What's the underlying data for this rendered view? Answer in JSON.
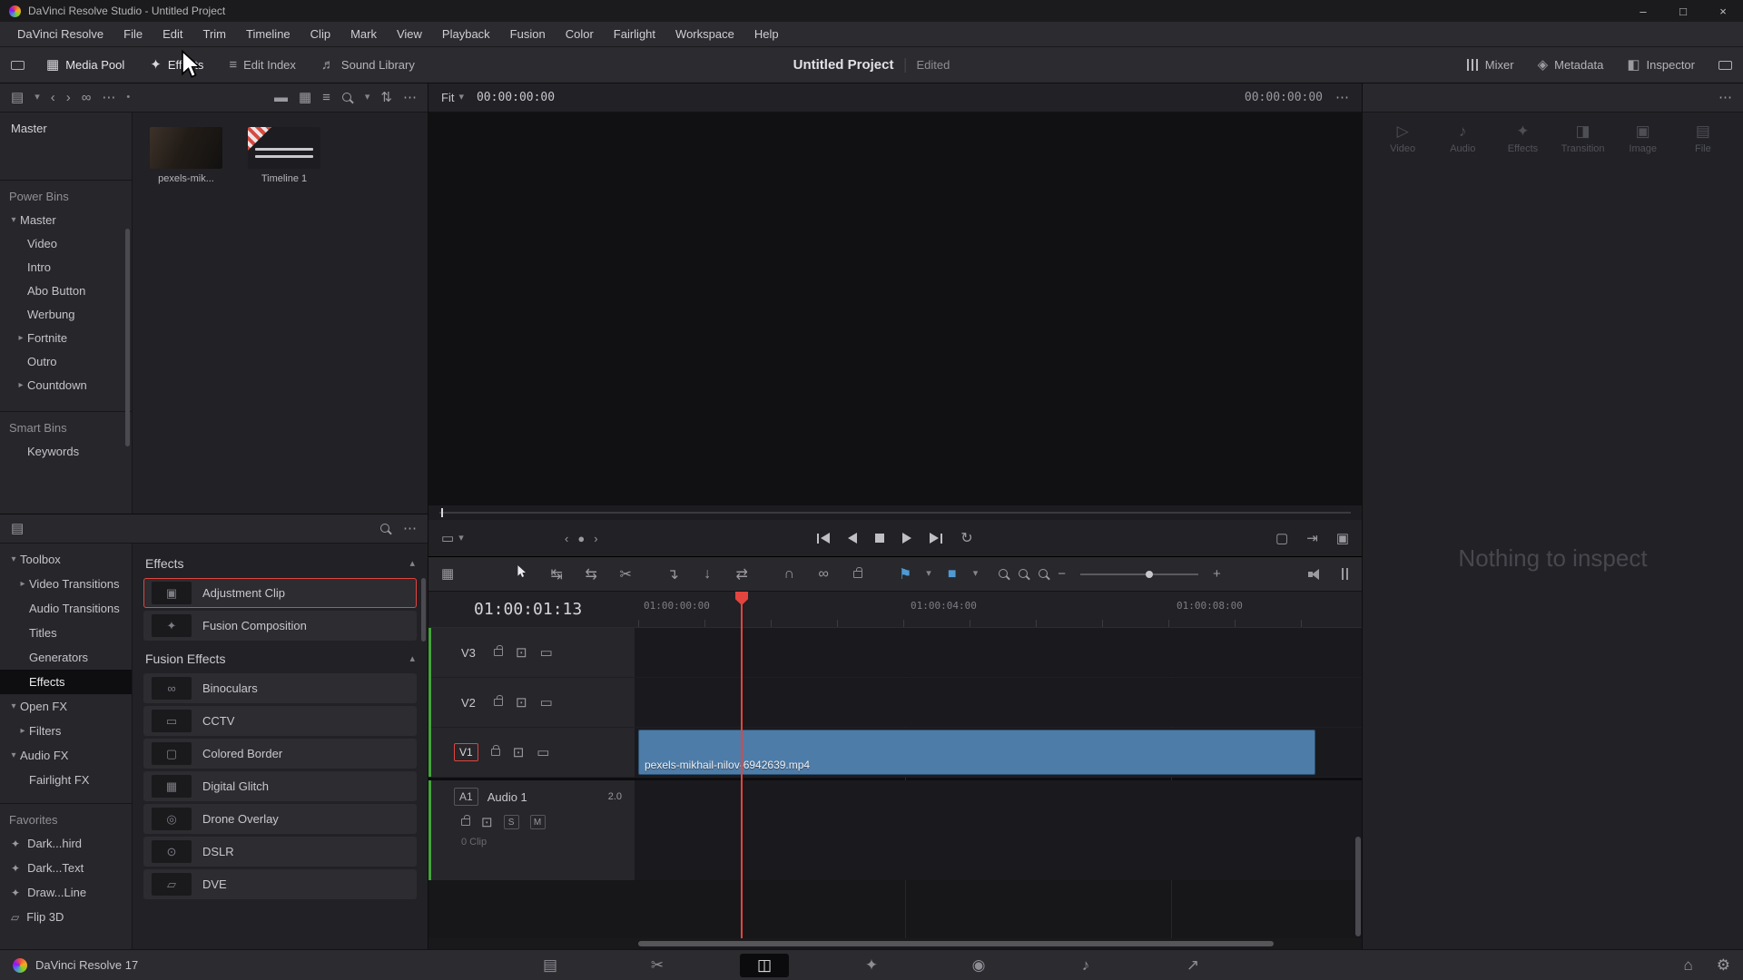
{
  "window": {
    "title": "DaVinci Resolve Studio - Untitled Project",
    "controls": {
      "minimize": "–",
      "maximize": "□",
      "close": "×"
    }
  },
  "menu": {
    "items": [
      "DaVinci Resolve",
      "File",
      "Edit",
      "Trim",
      "Timeline",
      "Clip",
      "Mark",
      "View",
      "Playback",
      "Fusion",
      "Color",
      "Fairlight",
      "Workspace",
      "Help"
    ]
  },
  "toolbar": {
    "media_pool": "Media Pool",
    "effects": "Effects",
    "edit_index": "Edit Index",
    "sound_library": "Sound Library",
    "project_title": "Untitled Project",
    "project_status": "Edited",
    "mixer": "Mixer",
    "metadata": "Metadata",
    "inspector": "Inspector"
  },
  "media_pool": {
    "root_bin": "Master",
    "power_bins_title": "Power Bins",
    "power_bins": [
      "Master",
      "Video",
      "Intro",
      "Abo Button",
      "Werbung",
      "Fortnite",
      "Outro",
      "Countdown"
    ],
    "smart_bins_title": "Smart Bins",
    "smart_bins": [
      "Keywords"
    ],
    "clips": [
      "pexels-mik...",
      "Timeline 1"
    ]
  },
  "effects_panel": {
    "tree": [
      "Toolbox",
      "Video Transitions",
      "Audio Transitions",
      "Titles",
      "Generators",
      "Effects",
      "Open FX",
      "Filters",
      "Audio FX",
      "Fairlight FX"
    ],
    "favorites_title": "Favorites",
    "favorites": [
      "Dark...hird",
      "Dark...Text",
      "Draw...Line",
      "Flip 3D"
    ],
    "effects_section_title": "Effects",
    "effects_items": [
      "Adjustment Clip",
      "Fusion Composition"
    ],
    "fusion_section_title": "Fusion Effects",
    "fusion_items": [
      "Binoculars",
      "CCTV",
      "Colored Border",
      "Digital Glitch",
      "Drone Overlay",
      "DSLR",
      "DVE"
    ]
  },
  "viewer": {
    "zoom_mode": "Fit",
    "timecode_left": "00:00:00:00",
    "timecode_right": "00:00:00:00"
  },
  "inspector": {
    "tabs": [
      "Video",
      "Audio",
      "Effects",
      "Transition",
      "Image",
      "File"
    ],
    "empty_message": "Nothing to inspect"
  },
  "timeline": {
    "playhead_timecode": "01:00:01:13",
    "ruler_labels": [
      "01:00:00:00",
      "01:00:04:00",
      "01:00:08:00"
    ],
    "video_tracks": [
      "V3",
      "V2",
      "V1"
    ],
    "audio_track": {
      "badge": "A1",
      "name": "Audio 1",
      "channels": "2.0",
      "clip_count": "0 Clip",
      "solo": "S",
      "mute": "M"
    },
    "clip_name": "pexels-mikhail-nilov-6942639.mp4"
  },
  "statusbar": {
    "app_version": "DaVinci Resolve 17"
  },
  "icons": {
    "chev_down": "▾",
    "chev_right": "▸",
    "chev_up": "▴",
    "back": "‹",
    "fwd": "›",
    "more": "⋯",
    "dot": "●",
    "small_dot": "•",
    "panel_toggle": "▤",
    "link": "∞",
    "view_film": "▬",
    "view_grid": "▦",
    "view_list": "≡",
    "sort": "⇅",
    "media_pool": "▦",
    "effects": "✦",
    "edit_index": "≡",
    "sound_library": "♬",
    "metadata": "◈",
    "inspector": "◧",
    "clip_mode": "▭",
    "loop": "↻",
    "box_outline": "▢",
    "to_bar": "⇥",
    "box_filled": "▣",
    "tl_view": "▦",
    "trim": "↹",
    "dyn_trim": "⇆",
    "razor": "✂",
    "insert": "↴",
    "overwrite": "↓",
    "replace": "⇄",
    "snap": "∩",
    "flag": "⚑",
    "marker": "■",
    "minus": "−",
    "plus": "+",
    "auto_select": "⊡",
    "patch": "▭",
    "home": "⌂",
    "gear": "⚙",
    "page_media": "▤",
    "page_cut": "✂",
    "page_edit": "◫",
    "page_fusion": "✦",
    "page_color": "◉",
    "page_fairlight": "♪",
    "page_deliver": "↗",
    "tab_video": "▷",
    "tab_audio": "♪",
    "tab_effects": "✦",
    "tab_transition": "◨",
    "tab_image": "▣",
    "tab_file": "▤",
    "star": "✦",
    "flip3d": "▱",
    "fx_adjustment": "▣",
    "fx_fusion_comp": "✦",
    "fx_binoculars": "∞",
    "fx_cctv": "▭",
    "fx_colored_border": "▢",
    "fx_digital_glitch": "▦",
    "fx_drone": "◎",
    "fx_dslr": "⊙",
    "fx_dve": "▱"
  },
  "colors": {
    "accent_red": "#e2453e",
    "clip_blue": "#4d7ca8",
    "marker_blue": "#4f9ad4",
    "track_strip_green": "#44a33c"
  }
}
